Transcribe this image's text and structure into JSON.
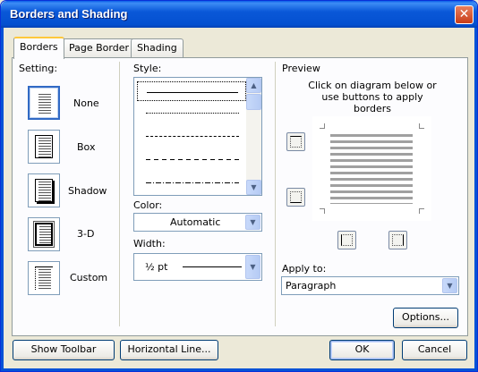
{
  "window": {
    "title": "Borders and Shading",
    "close_glyph": "✕"
  },
  "tabs": [
    {
      "label": "Borders",
      "active": true
    },
    {
      "label": "Page Border",
      "active": false
    },
    {
      "label": "Shading",
      "active": false
    }
  ],
  "setting": {
    "label": "Setting:",
    "options": [
      {
        "label": "None",
        "icon": "none-border-icon",
        "selected": true
      },
      {
        "label": "Box",
        "icon": "box-border-icon",
        "selected": false
      },
      {
        "label": "Shadow",
        "icon": "shadow-border-icon",
        "selected": false
      },
      {
        "label": "3-D",
        "icon": "3d-border-icon",
        "selected": false
      },
      {
        "label": "Custom",
        "icon": "custom-border-icon",
        "selected": false
      }
    ]
  },
  "style": {
    "label": "Style:",
    "items": [
      "solid",
      "dotted",
      "dashed-small",
      "dashed-large",
      "dash-dot"
    ],
    "selected": "solid"
  },
  "color": {
    "label": "Color:",
    "value": "Automatic"
  },
  "width": {
    "label": "Width:",
    "value": "½ pt"
  },
  "preview": {
    "label": "Preview",
    "instructions": "Click on diagram below or use buttons to apply borders"
  },
  "apply_to": {
    "label": "Apply to:",
    "value": "Paragraph"
  },
  "buttons": {
    "options": "Options...",
    "show_toolbar": "Show Toolbar",
    "horizontal_line": "Horizontal Line...",
    "ok": "OK",
    "cancel": "Cancel"
  },
  "colors": {
    "titlebar": "#0a58d8",
    "dialog_bg": "#ece9d8",
    "selection": "#316ac5",
    "close": "#c83c18"
  }
}
